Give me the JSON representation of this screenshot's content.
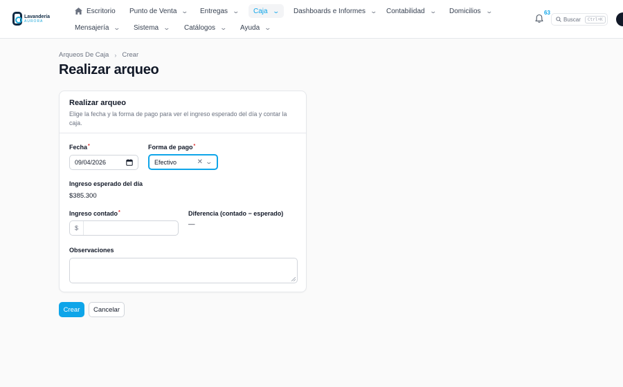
{
  "brand": {
    "name": "Lavandería",
    "sub": "AURORA"
  },
  "nav": {
    "row1": [
      {
        "label": "Escritorio"
      },
      {
        "label": "Punto de Venta"
      },
      {
        "label": "Entregas"
      },
      {
        "label": "Caja"
      },
      {
        "label": "Dashboards e Informes"
      },
      {
        "label": "Contabilidad"
      },
      {
        "label": "Domicilios"
      }
    ],
    "row2": [
      {
        "label": "Mensajería"
      },
      {
        "label": "Sistema"
      },
      {
        "label": "Catálogos"
      },
      {
        "label": "Ayuda"
      }
    ]
  },
  "notifications": {
    "count": "63"
  },
  "search": {
    "label": "Buscar",
    "shortcut": "Ctrl+K"
  },
  "breadcrumb": {
    "parent": "Arqueos De Caja",
    "current": "Crear"
  },
  "page": {
    "title": "Realizar arqueo"
  },
  "card": {
    "title": "Realizar arqueo",
    "description": "Elige la fecha y la forma de pago para ver el ingreso esperado del día y contar la caja."
  },
  "form": {
    "fecha": {
      "label": "Fecha",
      "value": "09/04/2026"
    },
    "forma_pago": {
      "label": "Forma de pago",
      "value": "Efectivo"
    },
    "ingreso_esperado": {
      "label": "Ingreso esperado del día",
      "value": "$385.300"
    },
    "ingreso_contado": {
      "label": "Ingreso contado",
      "prefix": "$",
      "value": ""
    },
    "diferencia": {
      "label": "Diferencia (contado − esperado)",
      "value": "—"
    },
    "observaciones": {
      "label": "Observaciones",
      "value": ""
    }
  },
  "actions": {
    "create": "Crear",
    "cancel": "Cancelar"
  },
  "colors": {
    "accent": "#0ea5e9",
    "required": "#dc2626",
    "brand_dark": "#0f2a44"
  },
  "icons": [
    "home-icon",
    "chevron-down-icon",
    "bell-icon",
    "search-icon",
    "calendar-icon",
    "clear-icon",
    "chevron-right-icon"
  ]
}
